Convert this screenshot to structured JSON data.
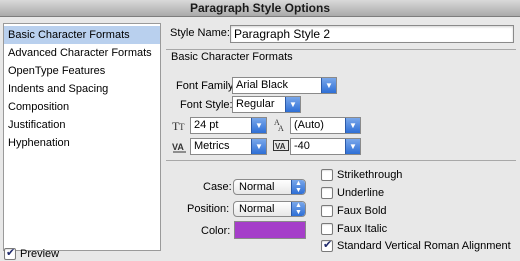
{
  "window": {
    "title": "Paragraph Style Options"
  },
  "sidebar": {
    "items": [
      {
        "label": "Basic Character Formats",
        "selected": true
      },
      {
        "label": "Advanced Character Formats"
      },
      {
        "label": "OpenType Features"
      },
      {
        "label": "Indents and Spacing"
      },
      {
        "label": "Composition"
      },
      {
        "label": "Justification"
      },
      {
        "label": "Hyphenation"
      }
    ]
  },
  "preview": {
    "label": "Preview",
    "checked": true
  },
  "style_name": {
    "label": "Style Name:",
    "value": "Paragraph Style 2"
  },
  "section": {
    "title": "Basic Character Formats"
  },
  "font_family": {
    "label": "Font Family:",
    "value": "Arial Black"
  },
  "font_style": {
    "label": "Font Style:",
    "value": "Regular"
  },
  "size": {
    "value": "24 pt",
    "icon": "font-size-icon"
  },
  "leading": {
    "value": "(Auto)",
    "icon": "leading-icon"
  },
  "kerning": {
    "value": "Metrics",
    "icon": "kerning-icon"
  },
  "tracking": {
    "value": "-40",
    "icon": "tracking-icon"
  },
  "case": {
    "label": "Case:",
    "value": "Normal"
  },
  "position": {
    "label": "Position:",
    "value": "Normal"
  },
  "color": {
    "label": "Color:",
    "swatch": "#a53ec9"
  },
  "options": [
    {
      "label": "Strikethrough",
      "checked": false
    },
    {
      "label": "Underline",
      "checked": false
    },
    {
      "label": "Faux Bold",
      "checked": false
    },
    {
      "label": "Faux Italic",
      "checked": false
    },
    {
      "label": "Standard Vertical Roman Alignment",
      "checked": true
    }
  ]
}
